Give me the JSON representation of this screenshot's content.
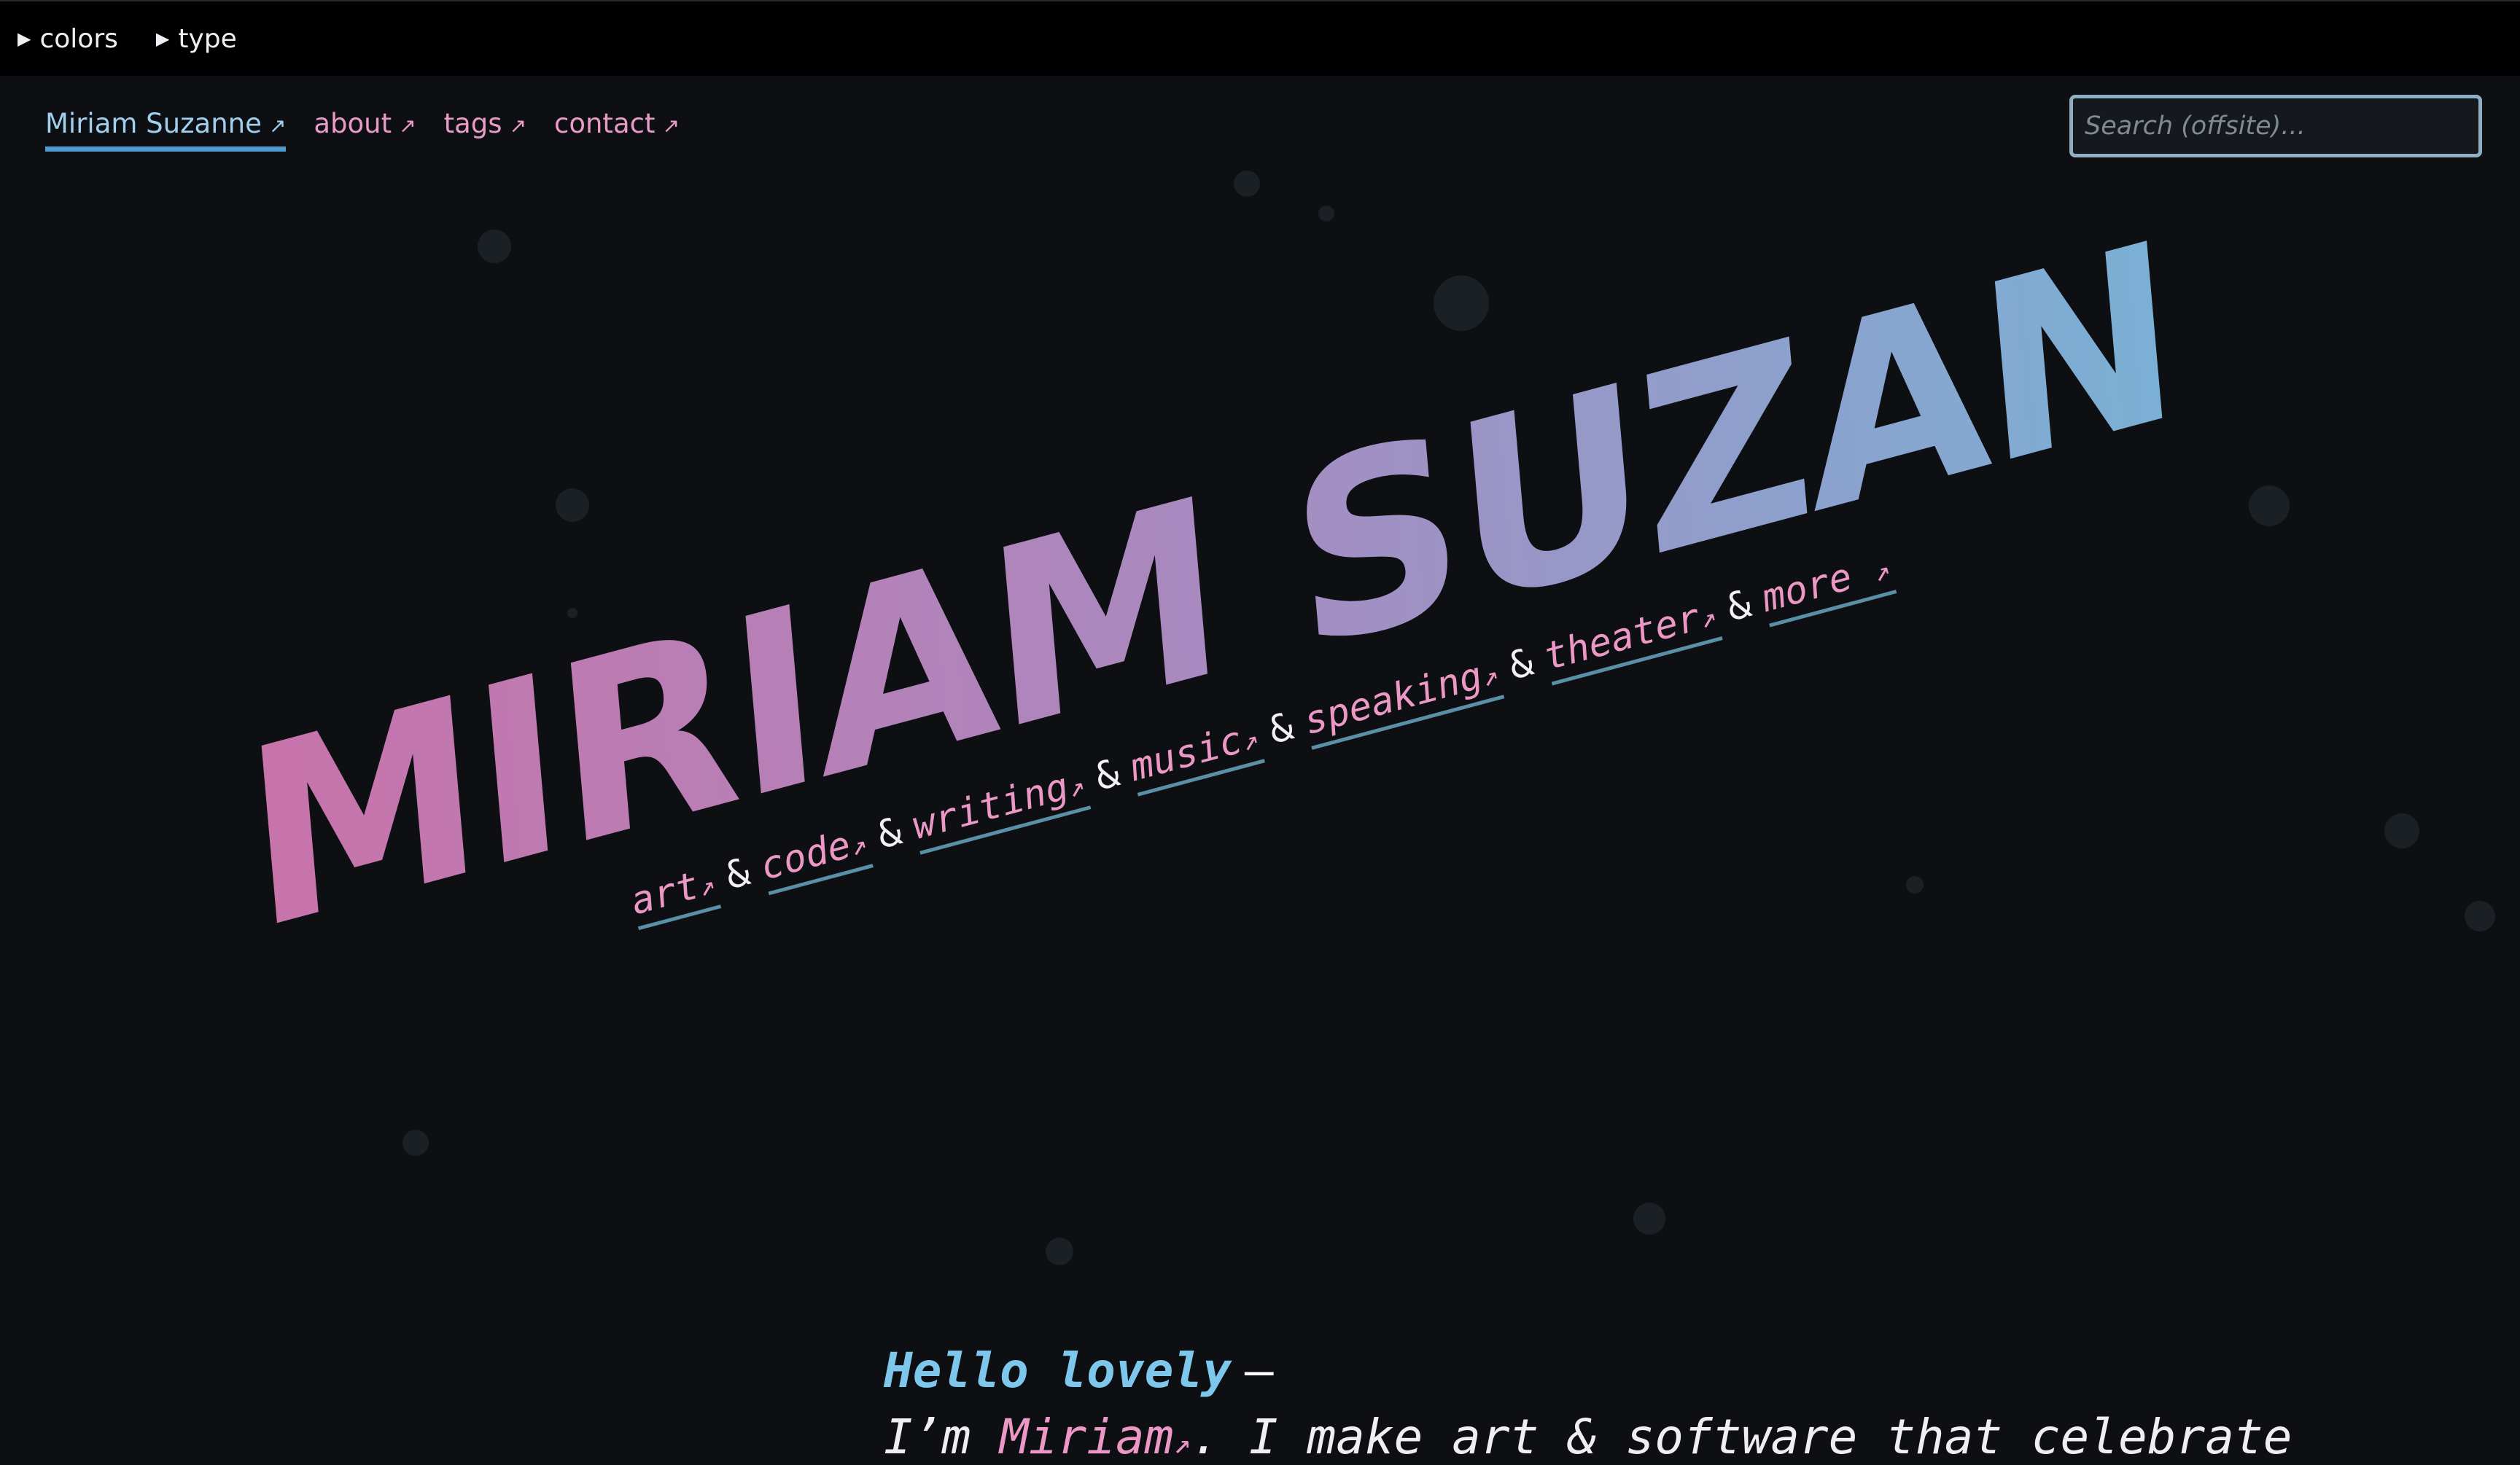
{
  "topbar": {
    "colors_label": "colors",
    "type_label": "type"
  },
  "nav": {
    "items": [
      {
        "label": "Miriam Suzanne",
        "arrow": "↗",
        "current": true
      },
      {
        "label": "about",
        "arrow": "↗"
      },
      {
        "label": "tags",
        "arrow": "↗"
      },
      {
        "label": "contact",
        "arrow": "↗"
      }
    ]
  },
  "search": {
    "placeholder": "Search (offsite)..."
  },
  "hero": {
    "title": "MIRIAM SUZANNE",
    "tags": [
      {
        "label": "art",
        "arrow": "↗"
      },
      {
        "label": "code",
        "arrow": "↗"
      },
      {
        "label": "writing",
        "arrow": "↗"
      },
      {
        "label": "music",
        "arrow": "↗"
      },
      {
        "label": "speaking",
        "arrow": "↗"
      },
      {
        "label": "theater",
        "arrow": "↗"
      },
      {
        "label": "more",
        "arrow": "↗"
      }
    ],
    "separator": "&"
  },
  "intro": {
    "greeting": "Hello lovely",
    "dash": "—",
    "lead": "I’m",
    "name": "Miriam",
    "arrow": "↗",
    "rest": ". I make art & software that celebrate"
  },
  "colors": {
    "background": "#0d0f12",
    "pink": "#e79bc6",
    "blue": "#7ec7ec",
    "gradient_start": "#c873aa",
    "gradient_end": "#79b1d6"
  }
}
